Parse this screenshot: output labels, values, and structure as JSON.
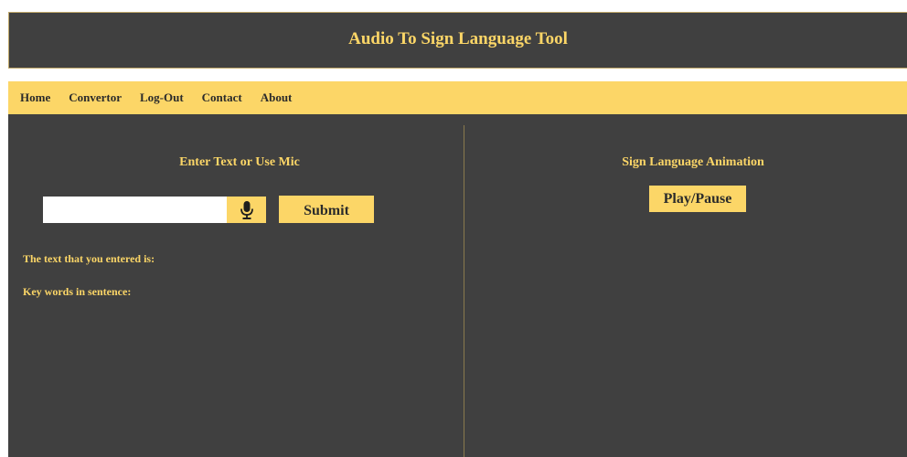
{
  "header": {
    "title": "Audio To Sign Language Tool"
  },
  "nav": {
    "items": [
      {
        "label": "Home"
      },
      {
        "label": "Convertor"
      },
      {
        "label": "Log-Out"
      },
      {
        "label": "Contact"
      },
      {
        "label": "About"
      }
    ]
  },
  "left_panel": {
    "title": "Enter Text or Use Mic",
    "input_value": "",
    "input_placeholder": "",
    "mic_icon": "microphone-icon",
    "submit_label": "Submit",
    "entered_text_label": "The text that you entered is:",
    "keywords_label": "Key words in sentence:"
  },
  "right_panel": {
    "title": "Sign Language Animation",
    "play_label": "Play/Pause"
  },
  "colors": {
    "accent": "#fcd667",
    "panel_bg": "#404040",
    "text_dark": "#2b2b2b"
  }
}
